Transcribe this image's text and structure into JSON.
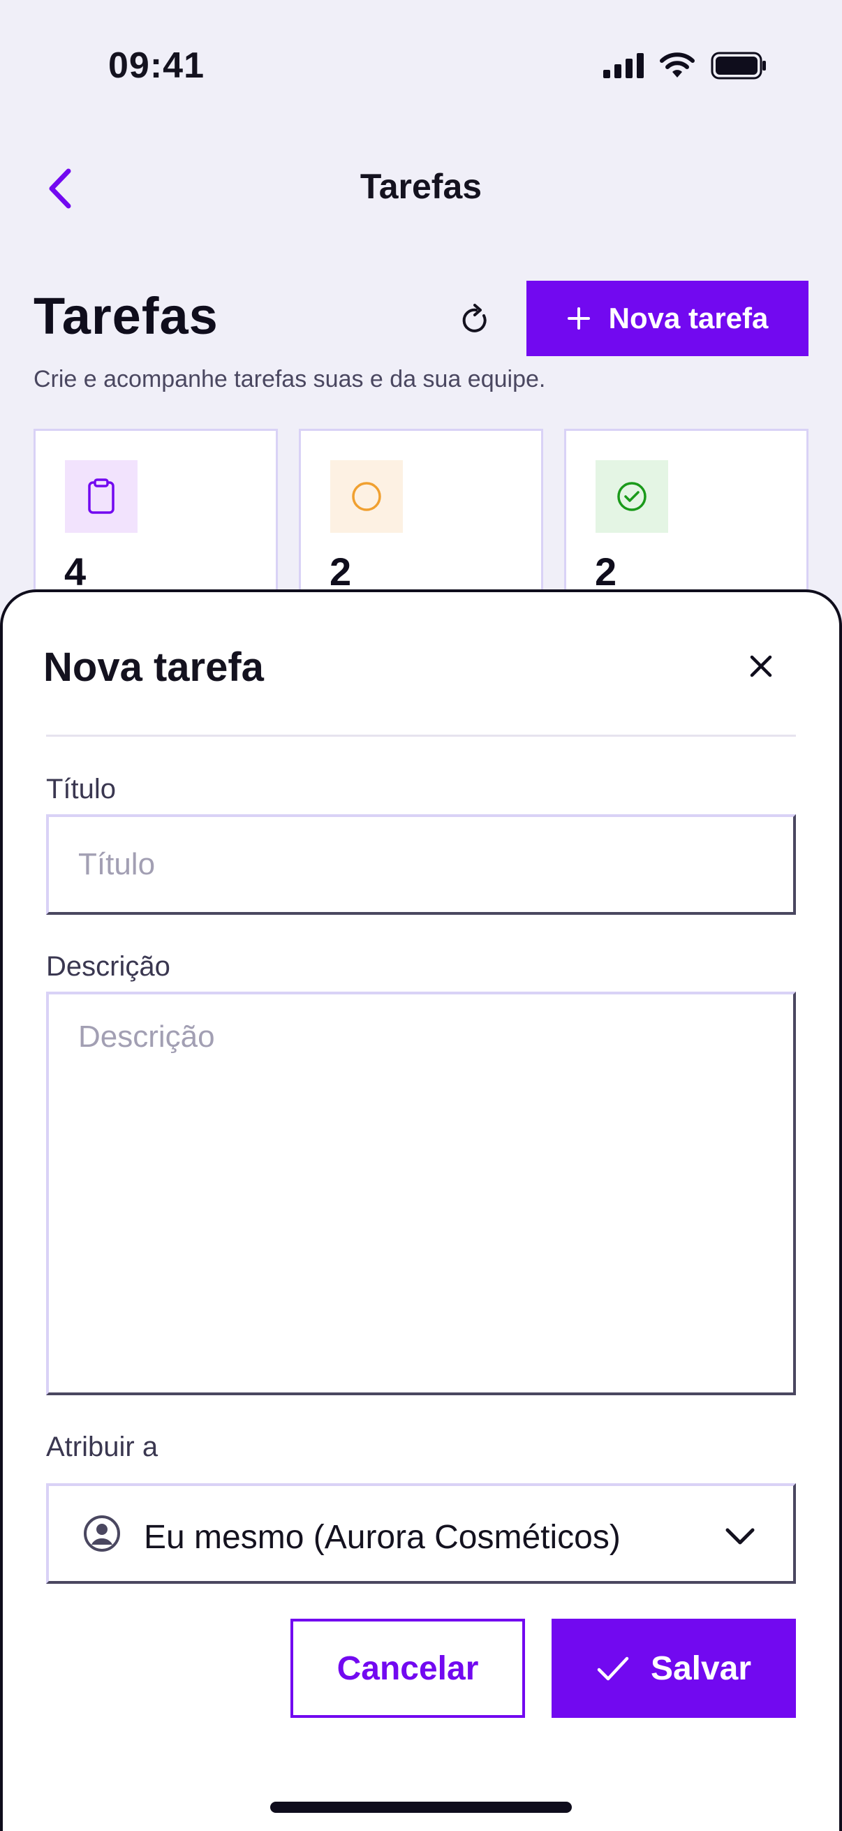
{
  "status_bar": {
    "time": "09:41"
  },
  "nav": {
    "title": "Tarefas"
  },
  "header": {
    "title": "Tarefas",
    "new_task_label": "Nova tarefa",
    "subtitle": "Crie e acompanhe tarefas suas e da sua equipe."
  },
  "stats": [
    {
      "icon": "clipboard-icon",
      "value": "4",
      "color": "#7209f0",
      "bg": "#f2e3fd"
    },
    {
      "icon": "circle-icon",
      "value": "2",
      "color": "#f0a030",
      "bg": "#fdf1e3"
    },
    {
      "icon": "check-circle-icon",
      "value": "2",
      "color": "#1a9a1a",
      "bg": "#e4f5e4"
    }
  ],
  "sheet": {
    "title": "Nova tarefa",
    "title_field": {
      "label": "Título",
      "placeholder": "Título",
      "value": ""
    },
    "description_field": {
      "label": "Descrição",
      "placeholder": "Descrição",
      "value": ""
    },
    "assign_field": {
      "label": "Atribuir a",
      "value": "Eu mesmo (Aurora Cosméticos)"
    },
    "cancel_label": "Cancelar",
    "save_label": "Salvar"
  },
  "colors": {
    "accent": "#7209f0",
    "background": "#f0eff8",
    "border": "#d9d2f6"
  }
}
